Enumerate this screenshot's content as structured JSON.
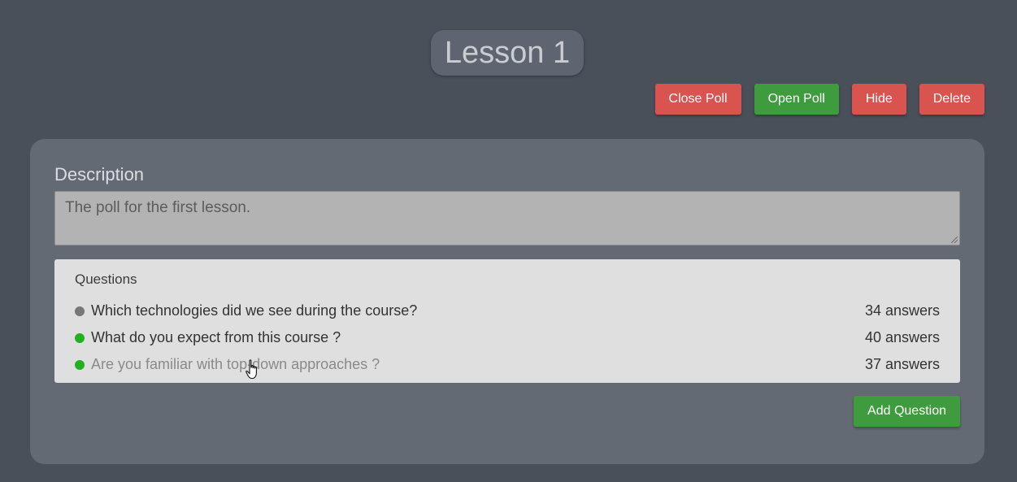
{
  "page": {
    "title": "Lesson 1"
  },
  "toolbar": {
    "close_poll": "Close Poll",
    "open_poll": "Open Poll",
    "hide": "Hide",
    "delete": "Delete"
  },
  "description": {
    "label": "Description",
    "value": "The poll for the first lesson."
  },
  "questions": {
    "header": "Questions",
    "items": [
      {
        "text": "Which technologies did we see during the course?",
        "answers": "34 answers",
        "status_color": "#777777"
      },
      {
        "text": "What do you expect from this course ?",
        "answers": "40 answers",
        "status_color": "#22b022"
      },
      {
        "text": "Are you familiar with top-down approaches ?",
        "answers": "37 answers",
        "status_color": "#22b022"
      }
    ]
  },
  "actions": {
    "add_question": "Add Question"
  },
  "colors": {
    "background": "#4a505a",
    "card": "#646a73",
    "danger": "#d9534f",
    "success": "#3e9b3e"
  }
}
